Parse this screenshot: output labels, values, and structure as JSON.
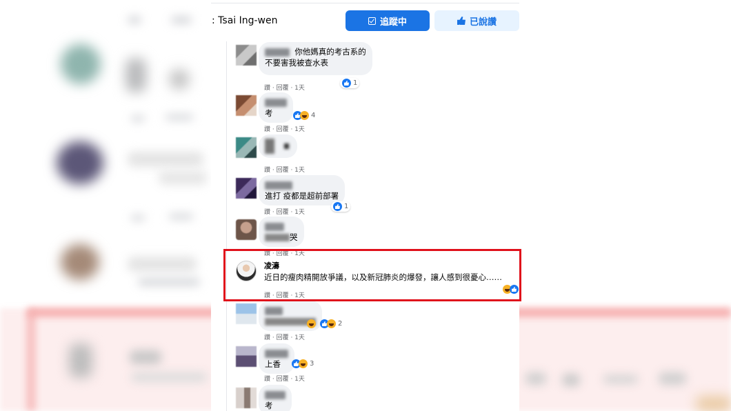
{
  "header": {
    "page_name": ": Tsai Ing-wen",
    "follow_button": "追蹤中",
    "like_button": "已說讚"
  },
  "comments": [
    {
      "text_line1": "你他媽真的考古系的",
      "text_line2": "不要害我被查水表",
      "meta": "讚 · 回覆 · 1天",
      "reaction_count": "1"
    },
    {
      "text": "考",
      "meta": "讚 · 回覆 · 1天",
      "reaction_count": "4"
    },
    {
      "meta": "讚 · 回覆 · 1天"
    },
    {
      "text": "進打 疫都是超前部署",
      "meta": "讚 · 回覆 · 1天",
      "reaction_count": "1"
    },
    {
      "text": "哭",
      "meta": "讚 · 回覆 · 1天"
    },
    {
      "name": "凌濤",
      "text": "近日的瘦肉精開放爭議，以及新冠肺炎的爆發，讓人感到很憂心……",
      "meta": "讚 · 回覆 · 1天"
    },
    {
      "meta": "讚 · 回覆 · 1天",
      "reaction_count": "2"
    },
    {
      "text": "上香",
      "meta": "讚 · 回覆 · 1天",
      "reaction_count": "3"
    },
    {
      "text": "考"
    }
  ],
  "colors": {
    "facebook_blue": "#1b74e4",
    "highlight_red": "#e0101b",
    "bubble_gray": "#f0f2f5"
  }
}
